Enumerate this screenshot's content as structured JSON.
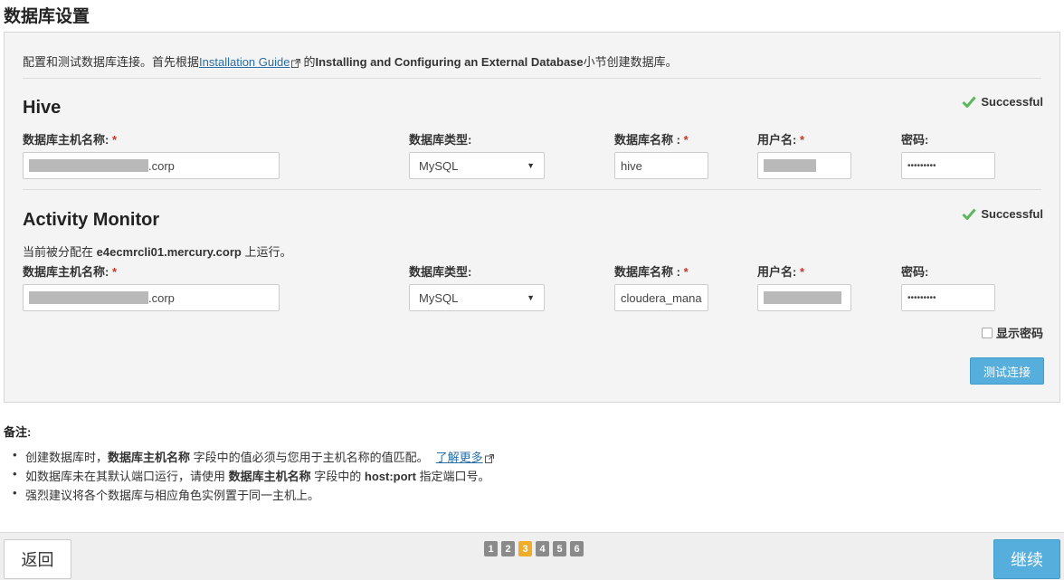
{
  "page_title": "数据库设置",
  "intro": {
    "prefix": "配置和测试数据库连接。首先根据",
    "link": "Installation Guide",
    "middle": "的",
    "bold": "Installing and Configuring an External Database",
    "suffix": "小节创建数据库。"
  },
  "labels": {
    "host": "数据库主机名称:",
    "type": "数据库类型:",
    "db_name": "数据库名称 :",
    "user": "用户名:",
    "password": "密码:",
    "required": "*"
  },
  "hive": {
    "title": "Hive",
    "status": "Successful",
    "host_suffix": ".corp",
    "db_type": "MySQL",
    "db_name": "hive",
    "password": "•••••••••"
  },
  "activity_monitor": {
    "title": "Activity Monitor",
    "status": "Successful",
    "assigned_prefix": "当前被分配在",
    "assigned_host": "e4ecmrcli01.mercury.corp",
    "assigned_suffix": "上运行。",
    "host_suffix": ".corp",
    "db_type": "MySQL",
    "db_name": "cloudera_mana",
    "password": "•••••••••"
  },
  "show_password": "显示密码",
  "test_connection": "测试连接",
  "notes": {
    "title": "备注:",
    "items": [
      {
        "a": "创建数据库时，",
        "b": "数据库主机名称",
        "c": "字段中的值必须与您用于主机名称的值匹配。",
        "link": "了解更多"
      },
      {
        "a": "如数据库未在其默认端口运行，请使用 ",
        "b": "数据库主机名称",
        "c": "字段中的 ",
        "d": "host:port",
        "e": " 指定端口号。"
      },
      {
        "a": "强烈建议将各个数据库与相应角色实例置于同一主机上。"
      }
    ]
  },
  "footer": {
    "back": "返回",
    "next": "继续",
    "steps": [
      "1",
      "2",
      "3",
      "4",
      "5",
      "6"
    ],
    "active_step": "3"
  },
  "colors": {
    "accent": "#56aedd",
    "success": "#5cb85c",
    "active_step": "#f0ad2a",
    "link": "#2a6ea6"
  }
}
